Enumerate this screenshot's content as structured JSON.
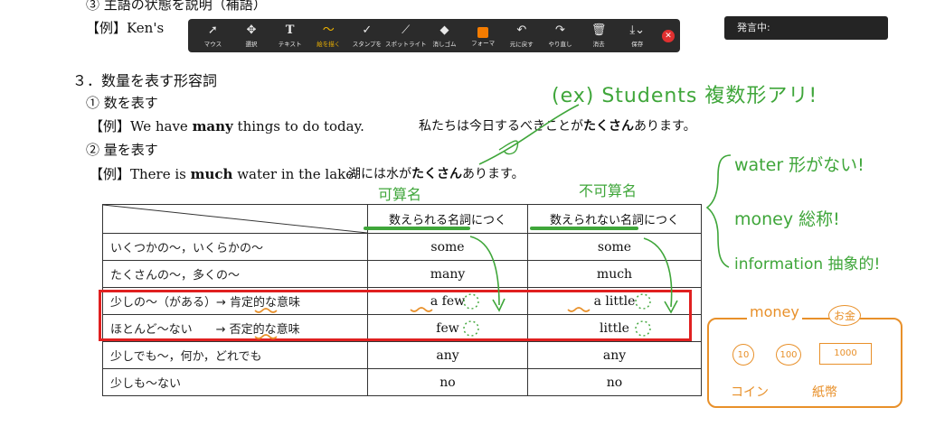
{
  "doc": {
    "cropped_heading": "③ 主語の状態を説明（補語）",
    "cropped_example": "【例】Ken's",
    "section_title": "３．数量を表す形容詞",
    "sub1": "① 数を表す",
    "ex1_en_pre": "【例】We have ",
    "ex1_en_bold": "many",
    "ex1_en_post": " things to do today.",
    "ex1_ja_pre": "私たちは今日するべきことが",
    "ex1_ja_bold": "たくさん",
    "ex1_ja_post": "あります。",
    "sub2": "② 量を表す",
    "ex2_en_pre": "【例】There is ",
    "ex2_en_bold": "much",
    "ex2_en_post": " water in the lake.",
    "ex2_ja_pre": "湖には水が",
    "ex2_ja_bold": "たくさん",
    "ex2_ja_post": "あります。"
  },
  "table": {
    "headers": [
      "",
      "数えられる名詞につく",
      "数えられない名詞につく"
    ],
    "rows": [
      {
        "meaning": "いくつかの～，いくらかの～",
        "countable": "some",
        "uncountable": "some"
      },
      {
        "meaning": "たくさんの～，多くの～",
        "countable": "many",
        "uncountable": "much"
      },
      {
        "meaning": "少しの～（がある）→ 肯定的な意味",
        "countable": "a few",
        "uncountable": "a little"
      },
      {
        "meaning": "ほとんど～ない　　→ 否定的な意味",
        "countable": "few",
        "uncountable": "little"
      },
      {
        "meaning": "少しでも～，何か，どれでも",
        "countable": "any",
        "uncountable": "any"
      },
      {
        "meaning": "少しも～ない",
        "countable": "no",
        "uncountable": "no"
      }
    ]
  },
  "toolbar": {
    "items": [
      {
        "label": "マウス",
        "icon": "cursor-icon"
      },
      {
        "label": "選択",
        "icon": "move-icon"
      },
      {
        "label": "テキスト",
        "icon": "text-icon"
      },
      {
        "label": "絵を描く",
        "icon": "draw-icon",
        "active": true
      },
      {
        "label": "スタンプを",
        "icon": "check-icon"
      },
      {
        "label": "スポットライト",
        "icon": "wand-icon"
      },
      {
        "label": "消しゴム",
        "icon": "eraser-icon"
      },
      {
        "label": "フォーマ",
        "icon": "format-swatch-icon"
      },
      {
        "label": "元に戻す",
        "icon": "undo-icon"
      },
      {
        "label": "やり直し",
        "icon": "redo-icon"
      },
      {
        "label": "消去",
        "icon": "trash-icon"
      },
      {
        "label": "保存",
        "icon": "save-icon"
      }
    ],
    "active_color": "#f0b400",
    "format_color": "#f57c00"
  },
  "speaking_label": "発言中:",
  "annotations": {
    "ex_note": "(ex) Students 複数形アリ!",
    "countable_note": "可算名",
    "uncountable_note": "不可算名",
    "water_note": "water 形がない!",
    "money_note": "money 総称!",
    "info_note": "information 抽象的!",
    "money_box_title": "money",
    "money_box_ja": "お金",
    "coin_10": "10",
    "coin_100": "100",
    "bill_1000": "1000",
    "coin_label": "コイン",
    "bill_label": "紙幣",
    "green": "#3fa63a",
    "orange": "#e8902a",
    "red": "#e02020"
  }
}
